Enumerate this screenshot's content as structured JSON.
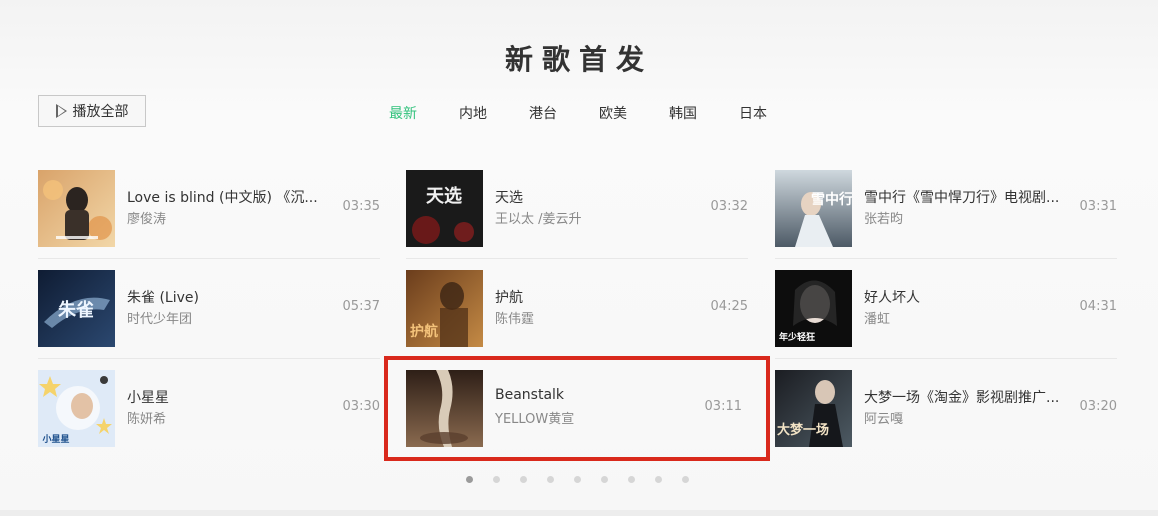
{
  "section": {
    "title": "新歌首发"
  },
  "toolbar": {
    "play_all_label": "播放全部"
  },
  "tabs": [
    {
      "label": "最新",
      "active": true
    },
    {
      "label": "内地",
      "active": false
    },
    {
      "label": "港台",
      "active": false
    },
    {
      "label": "欧美",
      "active": false
    },
    {
      "label": "韩国",
      "active": false
    },
    {
      "label": "日本",
      "active": false
    }
  ],
  "songs": [
    {
      "name": "Love is blind (中文版) 《沉...",
      "artist": "廖俊涛",
      "duration": "03:35"
    },
    {
      "name": "天选",
      "artist": "王以太 /姜云升",
      "duration": "03:32"
    },
    {
      "name": "雪中行《雪中悍刀行》电视剧...",
      "artist": "张若昀",
      "duration": "03:31"
    },
    {
      "name": "朱雀 (Live)",
      "artist": "时代少年团",
      "duration": "05:37"
    },
    {
      "name": "护航",
      "artist": "陈伟霆",
      "duration": "04:25"
    },
    {
      "name": "好人坏人",
      "artist": "潘虹",
      "duration": "04:31"
    },
    {
      "name": "小星星",
      "artist": "陈妍希",
      "duration": "03:30"
    },
    {
      "name": "Beanstalk",
      "artist": "YELLOW黄宣",
      "duration": "03:11"
    },
    {
      "name": "大梦一场《淘金》影视剧推广...",
      "artist": "阿云嘎",
      "duration": "03:20"
    }
  ],
  "covers": [
    {
      "icon": "album-cover-portrait",
      "text": "",
      "colors": [
        "#d9a36a",
        "#f2d7a8"
      ]
    },
    {
      "icon": "album-cover-text",
      "text": "天选",
      "colors": [
        "#1a1a1a",
        "#8c1a1a"
      ]
    },
    {
      "icon": "album-cover-text",
      "text": "雪中行",
      "colors": [
        "#cfd8de",
        "#4d5a66"
      ]
    },
    {
      "icon": "album-cover-text",
      "text": "朱雀",
      "colors": [
        "#0f1c33",
        "#2b4870"
      ]
    },
    {
      "icon": "album-cover-text",
      "text": "护航",
      "colors": [
        "#6b3d1c",
        "#c48a45"
      ]
    },
    {
      "icon": "album-cover-text",
      "text": "年少轻狂",
      "colors": [
        "#0d0d0d",
        "#3a3a3a"
      ]
    },
    {
      "icon": "album-cover-text",
      "text": "小星星",
      "colors": [
        "#dfeaf7",
        "#f5d36b"
      ]
    },
    {
      "icon": "album-cover-portrait",
      "text": "",
      "colors": [
        "#2e1f17",
        "#8a6a4f"
      ]
    },
    {
      "icon": "album-cover-text",
      "text": "大梦一场",
      "colors": [
        "#1b1d22",
        "#4d5a63"
      ]
    }
  ],
  "pager": {
    "dot_count": 9,
    "active_index": 0
  },
  "colors": {
    "accent": "#31c27c",
    "highlight": "#d9291c"
  }
}
